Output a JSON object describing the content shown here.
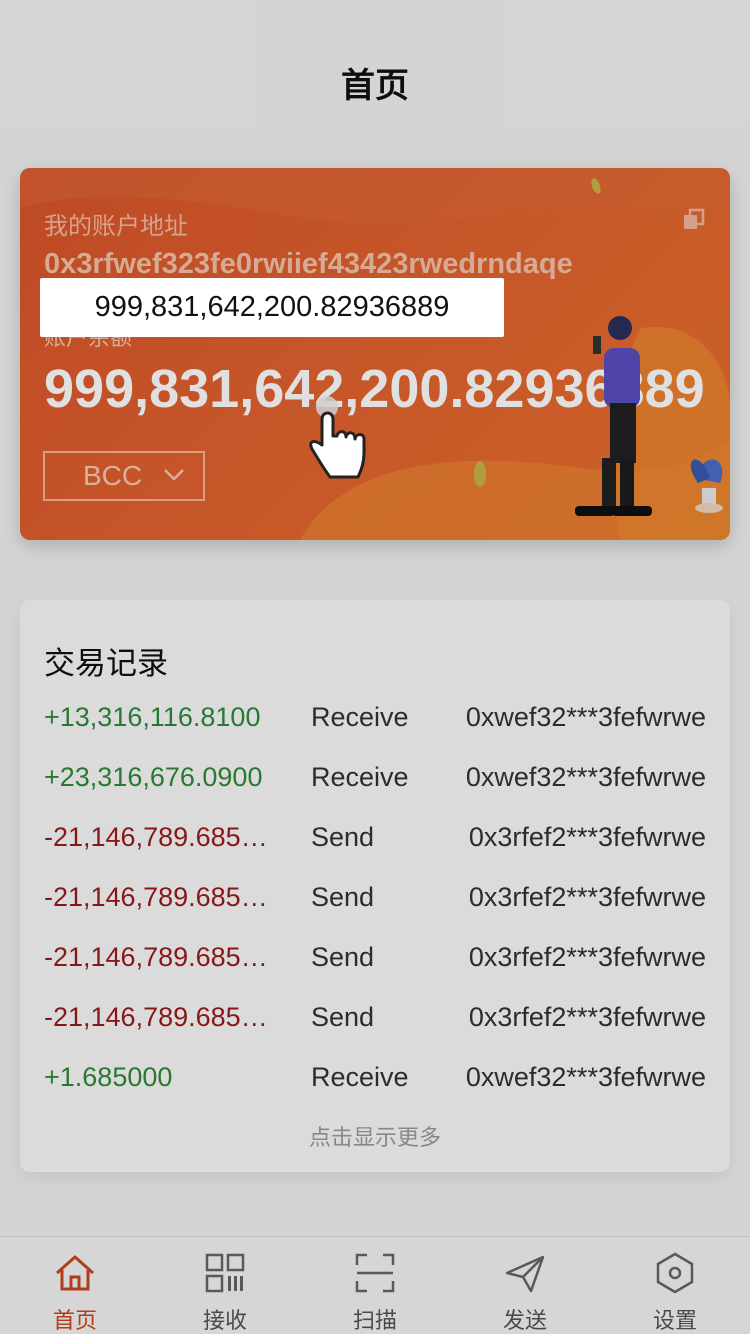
{
  "header": {
    "title": "首页"
  },
  "account": {
    "address_label": "我的账户地址",
    "address": "0x3rfwef323fe0rwiief43423rwedrndaqe",
    "balance_label": "账户余额",
    "balance": "999,831,642,200.82936889",
    "currency": "BCC",
    "icons": {
      "copy": "copy-icon",
      "dropdown": "chevron-down-icon"
    }
  },
  "tooltip": {
    "text": "999,831,642,200.82936889"
  },
  "records": {
    "title": "交易记录",
    "rows": [
      {
        "amount": "+13,316,116.8100",
        "type": "Receive",
        "address": "0xwef32***3fefwrwe"
      },
      {
        "amount": "+23,316,676.0900",
        "type": "Receive",
        "address": "0xwef32***3fefwrwe"
      },
      {
        "amount": "-21,146,789.685000",
        "type": "Send",
        "address": "0x3rfef2***3fefwrwe"
      },
      {
        "amount": "-21,146,789.685000",
        "type": "Send",
        "address": "0x3rfef2***3fefwrwe"
      },
      {
        "amount": "-21,146,789.685000",
        "type": "Send",
        "address": "0x3rfef2***3fefwrwe"
      },
      {
        "amount": "-21,146,789.685000",
        "type": "Send",
        "address": "0x3rfef2***3fefwrwe"
      },
      {
        "amount": "+1.685000",
        "type": "Receive",
        "address": "0xwef32***3fefwrwe"
      }
    ],
    "show_more": "点击显示更多"
  },
  "tabbar": {
    "items": [
      {
        "label": "首页",
        "icon": "home-icon",
        "active": true
      },
      {
        "label": "接收",
        "icon": "qrcode-icon",
        "active": false
      },
      {
        "label": "扫描",
        "icon": "scan-icon",
        "active": false
      },
      {
        "label": "发送",
        "icon": "send-icon",
        "active": false
      },
      {
        "label": "设置",
        "icon": "settings-icon",
        "active": false
      }
    ]
  },
  "colors": {
    "accent": "#c8461e",
    "card": "#e2622f",
    "positive": "#2f8a3a",
    "negative": "#9b1c1c"
  }
}
